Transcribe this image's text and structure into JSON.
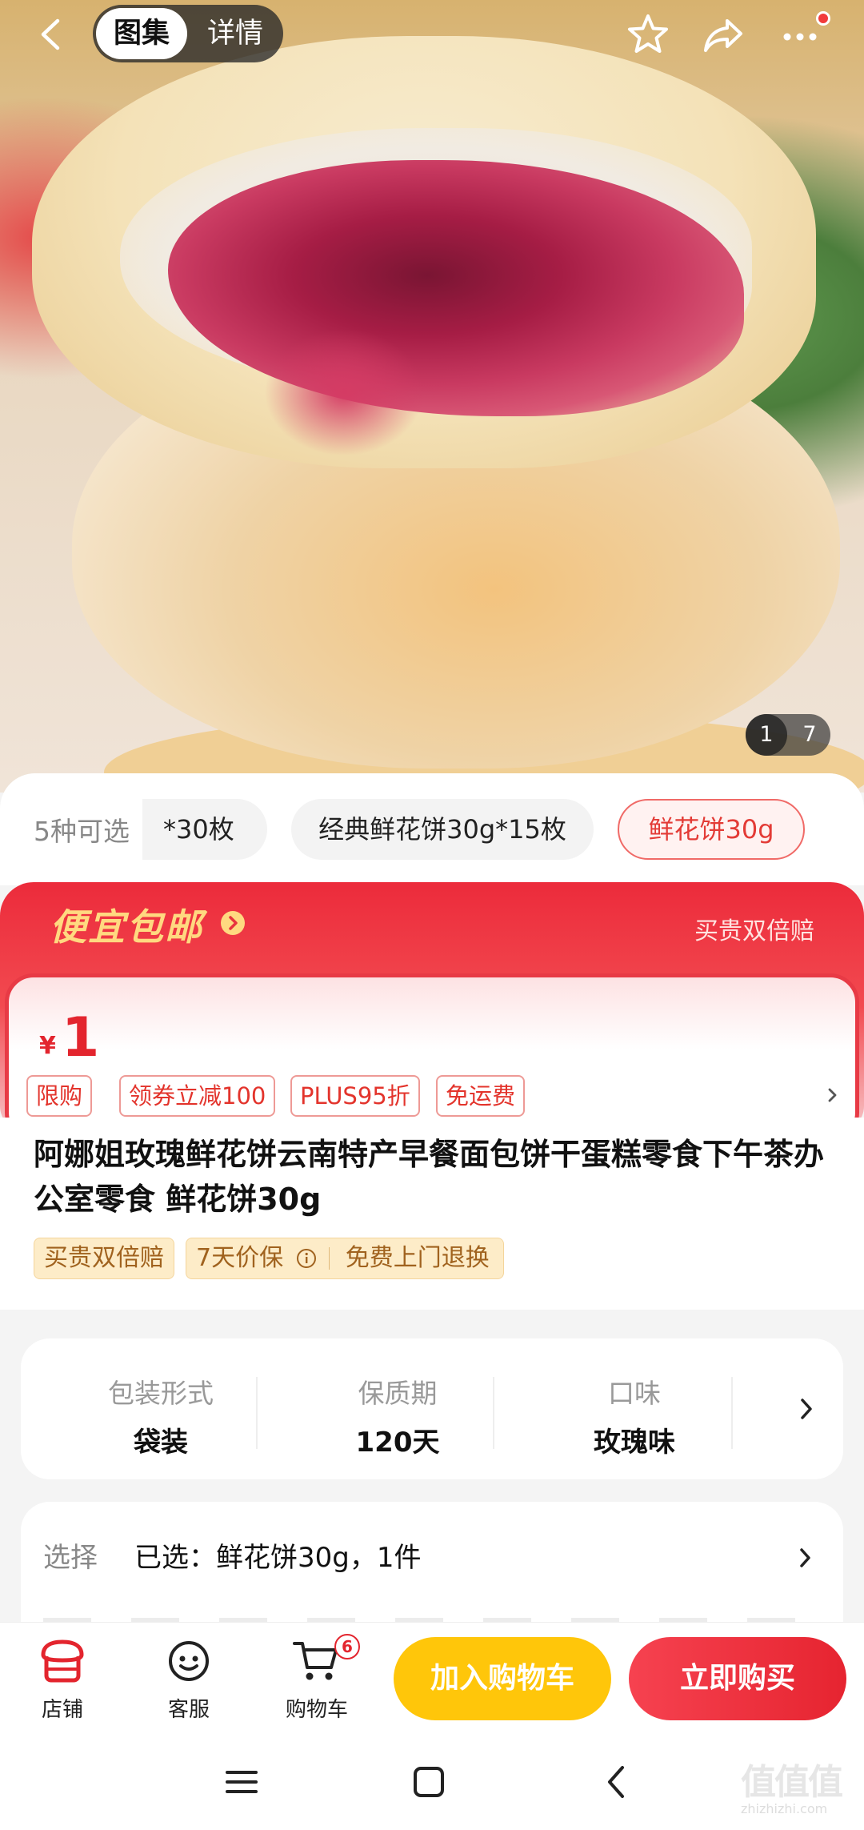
{
  "topbar": {
    "tab_gallery": "图集",
    "tab_detail": "详情",
    "back_icon": "back-arrow-icon",
    "star_icon": "star-icon",
    "share_icon": "share-icon",
    "more_icon": "more-icon"
  },
  "gallery": {
    "current": "1",
    "total": "7"
  },
  "specs": {
    "count_label": "5种可选",
    "options": [
      "*30枚",
      "经典鲜花饼30g*15枚",
      "鲜花饼30g"
    ],
    "selected_index": 2
  },
  "promo": {
    "title": "便宜包邮",
    "right_text": "买贵双倍赔",
    "currency": "¥",
    "price": "1",
    "tags": [
      "限购",
      "领券立减100",
      "PLUS95折",
      "免运费"
    ]
  },
  "product": {
    "title": "阿娜姐玫瑰鲜花饼云南特产早餐面包饼干蛋糕零食下午茶办公室零食 鲜花饼30g",
    "badges": [
      "买贵双倍赔",
      "7天价保",
      "免费上门退换"
    ]
  },
  "attributes": [
    {
      "key": "包装形式",
      "value": "袋装"
    },
    {
      "key": "保质期",
      "value": "120天"
    },
    {
      "key": "口味",
      "value": "玫瑰味"
    }
  ],
  "selection": {
    "label": "选择",
    "value": "已选：鲜花饼30g，1件"
  },
  "actionbar": {
    "shop": "店铺",
    "service": "客服",
    "cart": "购物车",
    "cart_count": "6",
    "add_to_cart": "加入购物车",
    "buy_now": "立即购买"
  },
  "colors": {
    "accent_red": "#e3252e",
    "cart_yellow": "#ffc60a",
    "promo_gold": "#ffd980"
  },
  "watermark": {
    "main": "值值值",
    "sub": "zhizhizhi.com"
  }
}
